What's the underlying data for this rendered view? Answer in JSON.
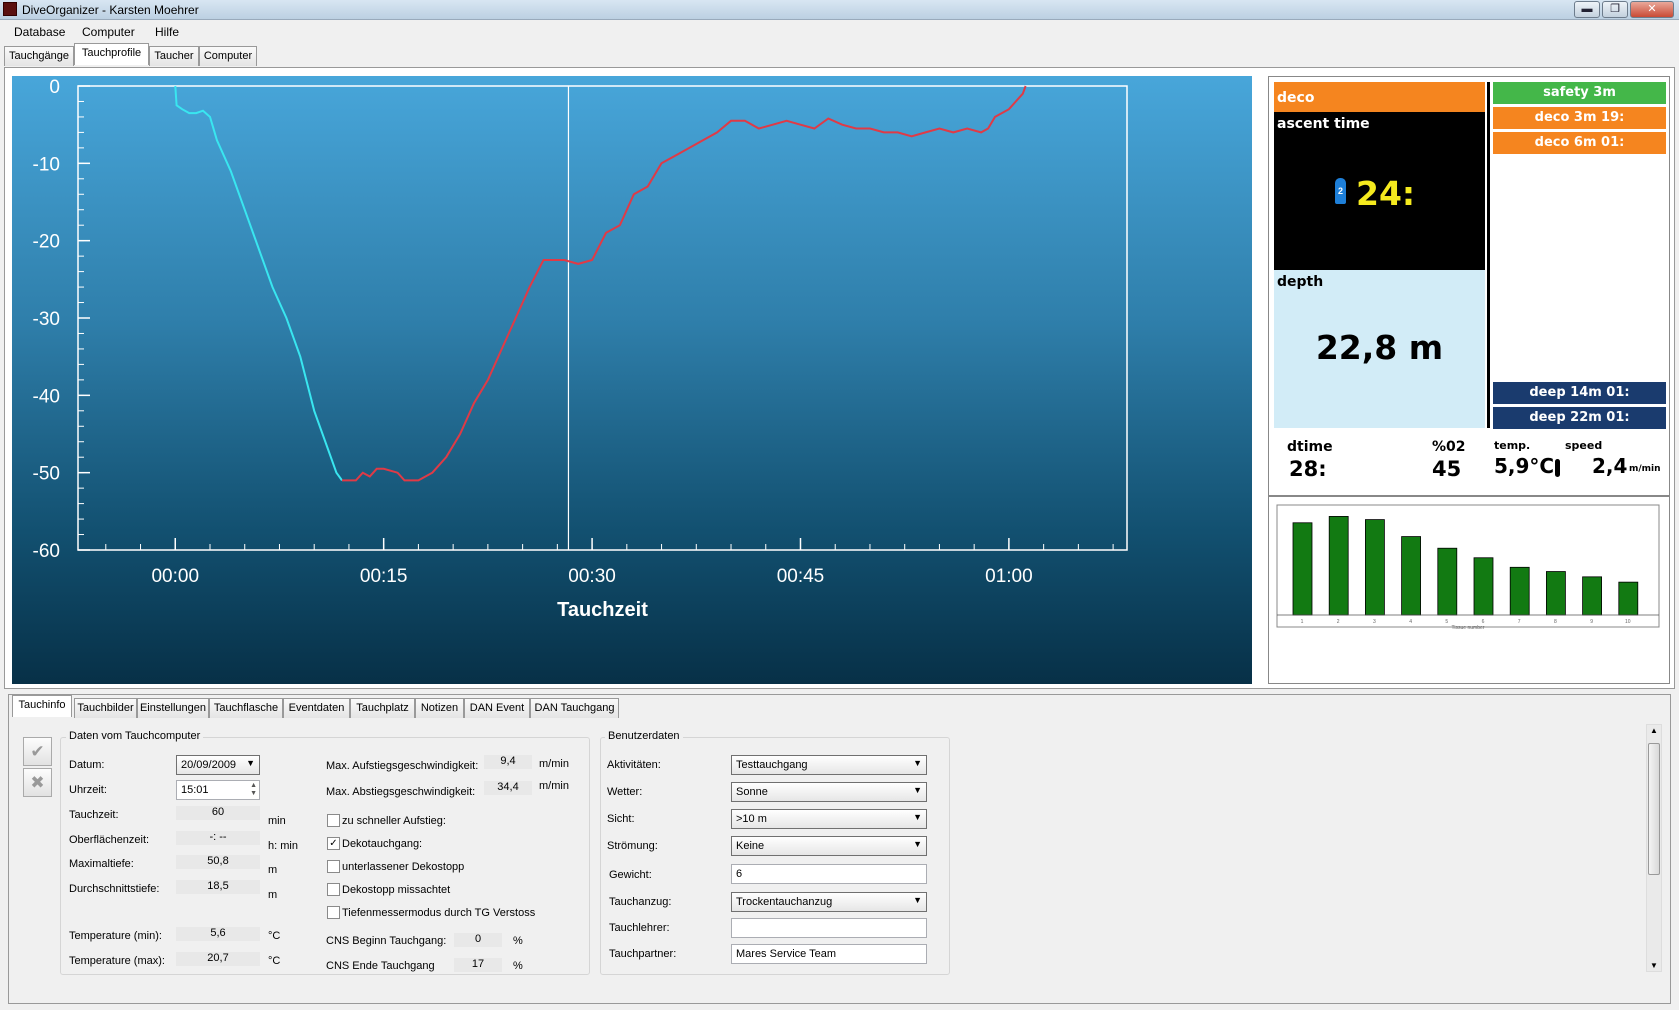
{
  "window": {
    "title": "DiveOrganizer - Karsten Moehrer",
    "minimize": "▬",
    "restore": "❐",
    "close": "✕"
  },
  "menu": [
    "Database",
    "Computer",
    "Hilfe"
  ],
  "top_tabs": [
    "Tauchgänge",
    "Tauchprofile",
    "Taucher",
    "Computer"
  ],
  "chart_data": {
    "type": "line",
    "xlabel": "Tauchzeit",
    "x_ticks": [
      "00:00",
      "00:15",
      "00:30",
      "00:45",
      "01:00"
    ],
    "y_ticks": [
      "0",
      "-10",
      "-20",
      "-30",
      "-40",
      "-50",
      "-60"
    ],
    "xlim": [
      -7,
      68.5
    ],
    "ylim": [
      -60,
      0
    ],
    "cursor_minute": 28.3,
    "colors": {
      "descent": "#39e6f0",
      "ascent": "#e03a46"
    },
    "series": [
      {
        "values": [
          [
            0,
            0
          ],
          [
            0.1,
            -2.5
          ],
          [
            0.5,
            -3
          ],
          [
            1,
            -3.5
          ],
          [
            1.5,
            -3.5
          ],
          [
            2,
            -3.2
          ],
          [
            2.5,
            -4
          ],
          [
            3,
            -7
          ],
          [
            4,
            -11
          ],
          [
            5,
            -16
          ],
          [
            6,
            -21
          ],
          [
            7,
            -26
          ],
          [
            8,
            -30
          ],
          [
            9,
            -35
          ],
          [
            10,
            -42
          ],
          [
            11,
            -47
          ],
          [
            11.6,
            -50
          ],
          [
            12,
            -51
          ]
        ]
      },
      {
        "values": [
          [
            12,
            -51
          ],
          [
            13,
            -51
          ],
          [
            13.5,
            -50
          ],
          [
            14,
            -50.5
          ],
          [
            14.5,
            -49.5
          ],
          [
            15,
            -49.5
          ],
          [
            16,
            -50
          ],
          [
            16.5,
            -51
          ],
          [
            17.5,
            -51
          ],
          [
            18.5,
            -50
          ],
          [
            19.5,
            -48
          ],
          [
            20.5,
            -45
          ],
          [
            21.5,
            -41
          ],
          [
            22.5,
            -38
          ],
          [
            23.5,
            -34
          ],
          [
            24.5,
            -30
          ],
          [
            25.5,
            -26
          ],
          [
            26.5,
            -22.5
          ],
          [
            28,
            -22.5
          ],
          [
            29,
            -23
          ],
          [
            30,
            -22.5
          ],
          [
            31,
            -19
          ],
          [
            32,
            -18
          ],
          [
            33,
            -14
          ],
          [
            34,
            -13
          ],
          [
            35,
            -10
          ],
          [
            36,
            -9
          ],
          [
            37,
            -8
          ],
          [
            38,
            -7
          ],
          [
            39,
            -6
          ],
          [
            40,
            -4.5
          ],
          [
            41,
            -4.5
          ],
          [
            42,
            -5.5
          ],
          [
            43,
            -5
          ],
          [
            44,
            -4.5
          ],
          [
            45,
            -5
          ],
          [
            46,
            -5.5
          ],
          [
            47,
            -4.2
          ],
          [
            48,
            -5
          ],
          [
            49,
            -5.5
          ],
          [
            50,
            -5.5
          ],
          [
            51,
            -6
          ],
          [
            52,
            -6
          ],
          [
            53,
            -6.5
          ],
          [
            54,
            -6
          ],
          [
            55,
            -5.5
          ],
          [
            56,
            -6
          ],
          [
            57,
            -5.5
          ],
          [
            58,
            -6
          ],
          [
            58.5,
            -5.5
          ],
          [
            59,
            -4
          ],
          [
            60,
            -3
          ],
          [
            60.5,
            -2
          ],
          [
            61,
            -1
          ],
          [
            61.2,
            0
          ]
        ]
      }
    ]
  },
  "deco": {
    "deco_title": "deco",
    "ascent_label": "ascent time",
    "tank": "2",
    "ascent_value": "24:",
    "depth_label": "depth",
    "depth_value": "22,8 m",
    "stops": [
      "safety 3m",
      "deco 3m 19:",
      "deco 6m 01:"
    ],
    "deep_stops": [
      "deep 14m 01:",
      "deep 22m 01:"
    ],
    "dtime_label": "dtime",
    "dtime_value": "28:",
    "o2_label": "%02",
    "o2_value": "45",
    "temp_label": "temp.",
    "temp_value": "5,9°C",
    "speed_label": "speed",
    "speed_value": "2,4",
    "speed_unit": "m/min",
    "colors": {
      "orange": "#f5851f",
      "green": "#44b749",
      "navy": "#1a3b6e",
      "lightblue": "#d2ecf7"
    }
  },
  "bar_chart": {
    "values": [
      8.7,
      9.3,
      9.0,
      7.4,
      6.3,
      5.4,
      4.5,
      4.1,
      3.6,
      3.1
    ],
    "ticks": [
      "1",
      "2",
      "3",
      "4",
      "5",
      "6",
      "7",
      "8",
      "9",
      "10"
    ],
    "xlabel": "Tissue number",
    "color": "#127a12"
  },
  "bottom_tabs": [
    "Tauchinfo",
    "Tauchbilder",
    "Einstellungen",
    "Tauchflasche",
    "Eventdaten",
    "Tauchplatz",
    "Notizen",
    "DAN Event",
    "DAN Tauchgang"
  ],
  "computer": {
    "legend": "Daten vom Tauchcomputer",
    "datum_label": "Datum:",
    "datum": "20/09/2009",
    "uhrzeit_label": "Uhrzeit:",
    "uhrzeit": "15:01",
    "tauchzeit_label": "Tauchzeit:",
    "tauchzeit": "60",
    "tauchzeit_unit": "min",
    "oberflaeche_label": "Oberflächenzeit:",
    "oberflaeche": "-: --",
    "oberflaeche_unit": "h: min",
    "maxtiefe_label": "Maximaltiefe:",
    "maxtiefe": "50,8",
    "maxtiefe_unit": "m",
    "durchschnitt_label": "Durchschnittstiefe:",
    "durchschnitt": "18,5",
    "durchschnitt_unit": "m",
    "tmin_label": "Temperature (min):",
    "tmin": "5,6",
    "tmin_unit": "°C",
    "tmax_label": "Temperature (max):",
    "tmax": "20,7",
    "tmax_unit": "°C",
    "aufstieg_label": "Max. Aufstiegsgeschwindigkeit:",
    "aufstieg": "9,4",
    "aufstieg_unit": "m/min",
    "abstieg_label": "Max. Abstiegsgeschwindigkeit:",
    "abstieg": "34,4",
    "abstieg_unit": "m/min",
    "checks": [
      {
        "label": "zu schneller Aufstieg:",
        "mark": ""
      },
      {
        "label": "Dekotauchgang:",
        "mark": "✓"
      },
      {
        "label": "unterlassener Dekostopp",
        "mark": ""
      },
      {
        "label": "Dekostopp missachtet",
        "mark": ""
      },
      {
        "label": "Tiefenmessermodus durch TG Verstoss",
        "mark": ""
      }
    ],
    "cns_begin_label": "CNS Beginn Tauchgang:",
    "cns_begin": "0",
    "cns_unit": "%",
    "cns_end_label": "CNS Ende Tauchgang",
    "cns_end": "17"
  },
  "user": {
    "legend": "Benutzerdaten",
    "aktivitaeten_label": "Aktivitäten:",
    "aktivitaeten": "Testtauchgang",
    "wetter_label": "Wetter:",
    "wetter": "Sonne",
    "sicht_label": "Sicht:",
    "sicht": ">10 m",
    "stroemung_label": "Strömung:",
    "stroemung": "Keine",
    "gewicht_label": "Gewicht:",
    "gewicht": "6",
    "anzug_label": "Tauchanzug:",
    "anzug": "Trockentauchanzug",
    "lehrer_label": "Tauchlehrer:",
    "lehrer": "",
    "partner_label": "Tauchpartner:",
    "partner": "Mares Service Team"
  }
}
